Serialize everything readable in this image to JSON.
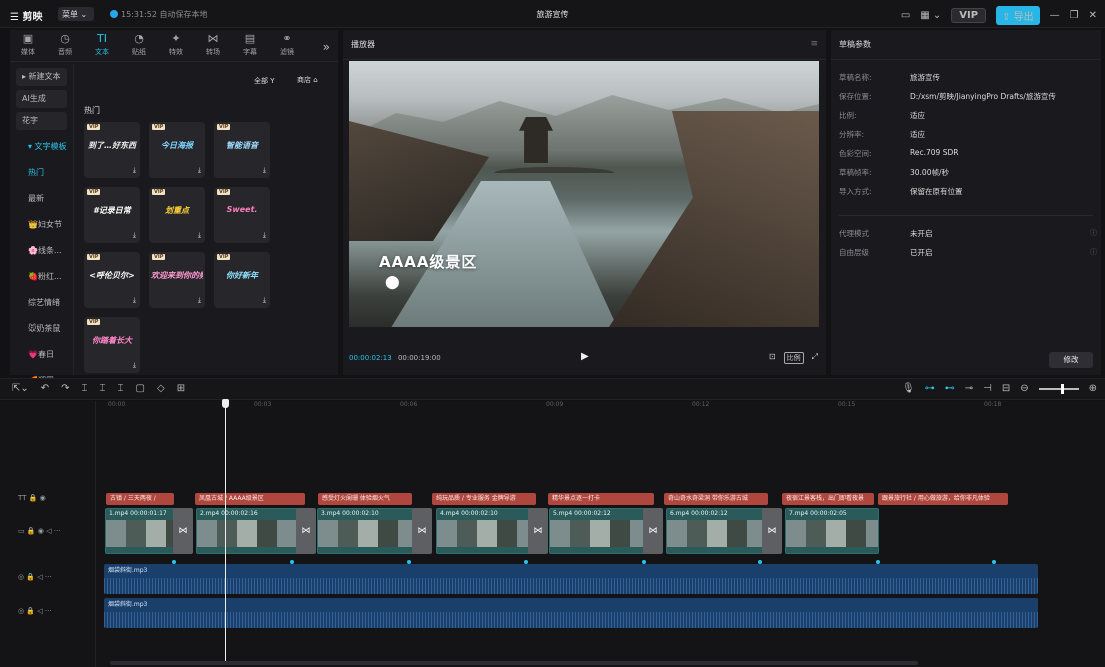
{
  "app": {
    "brand": "剪映",
    "menu_label": "菜单 ⌄",
    "save_status": "15:31:52 自动保存本地",
    "window_title": "旅游宣传",
    "vip_label": "VIP",
    "export_label": "导出"
  },
  "colors": {
    "accent": "#27c3e8",
    "text_clip": "#b0473f",
    "video_clip": "#2a5a5a",
    "audio_clip": "#1a3f6b"
  },
  "left_panel": {
    "tabs": [
      {
        "label": "媒体",
        "icon": "media-icon"
      },
      {
        "label": "音频",
        "icon": "audio-icon"
      },
      {
        "label": "文本",
        "icon": "text-icon",
        "active": true
      },
      {
        "label": "贴纸",
        "icon": "sticker-icon"
      },
      {
        "label": "特效",
        "icon": "effects-icon"
      },
      {
        "label": "转场",
        "icon": "transition-icon"
      },
      {
        "label": "字幕",
        "icon": "subtitle-icon"
      },
      {
        "label": "滤镜",
        "icon": "filter-icon"
      }
    ],
    "categories": [
      "▸ 新建文本",
      "AI生成",
      "花字",
      "▾ 文字模板",
      "热门",
      "最新",
      "👑妇女节",
      "🌸线条...",
      "🍓粉红...",
      "综艺情绪",
      "🐭奶茶鼠",
      "💗春日",
      "🌈遛罗..."
    ],
    "filter_label": "全部",
    "store_label": "商店",
    "section_title": "热门",
    "templates": [
      {
        "text": "到了…好东西",
        "color": "#f0f0f0"
      },
      {
        "text": "今日海报",
        "color": "#7fd6ff"
      },
      {
        "text": "智能语音",
        "color": "#9fdcff"
      },
      {
        "text": "#记录日常",
        "color": "#ffffff"
      },
      {
        "text": "划重点",
        "color": "#ffd23a"
      },
      {
        "text": "Sweet.",
        "color": "#ff7fbf"
      },
      {
        "text": "<呼伦贝尔>",
        "color": "#ffffff"
      },
      {
        "text": "欢迎来到你的频道",
        "color": "#ff9bd0"
      },
      {
        "text": "你好新年",
        "color": "#8fe3ff"
      },
      {
        "text": "你踏着长大",
        "color": "#ff86c8"
      }
    ]
  },
  "player": {
    "title": "播放器",
    "overlay_text": "AAAA级景区",
    "current_time": "00:00:02:13",
    "total_time": "00:00:19:00",
    "ratio_label": "比例"
  },
  "draft": {
    "title": "草稿参数",
    "fields": [
      {
        "label": "草稿名称:",
        "value": "旅游宣传"
      },
      {
        "label": "保存位置:",
        "value": "D:/xsm/剪映/JianyingPro Drafts/旅游宣传"
      },
      {
        "label": "比例:",
        "value": "适应"
      },
      {
        "label": "分辨率:",
        "value": "适应"
      },
      {
        "label": "色彩空间:",
        "value": "Rec.709 SDR"
      },
      {
        "label": "草稿帧率:",
        "value": "30.00帧/秒"
      },
      {
        "label": "导入方式:",
        "value": "保留在原有位置"
      }
    ],
    "extra": [
      {
        "label": "代理模式",
        "value": "未开启"
      },
      {
        "label": "自由层级",
        "value": "已开启"
      }
    ],
    "modify_label": "修改"
  },
  "timeline": {
    "ruler": [
      "00:00",
      "00:03",
      "00:06",
      "00:09",
      "00:12",
      "00:15",
      "00:18"
    ],
    "text_clips": [
      "古镇 / 三天两夜 /",
      "凤凰古城 / AAAA级景区",
      "感受灯火阑珊 体验烟火气",
      "纯玩品质 / 专业服务 金牌导游",
      "精华景点逐一打卡",
      "奇山奇水奇梁洞 带你乐游古城",
      "夜宿江景客栈，出门即看夜景",
      "跟景旅行社 / 用心做旅游，给你非凡体验"
    ],
    "video_clips": [
      {
        "name": "1.mp4",
        "duration": "00:00:01:17"
      },
      {
        "name": "2.mp4",
        "duration": "00:00:02:16"
      },
      {
        "name": "3.mp4",
        "duration": "00:00:02:10"
      },
      {
        "name": "4.mp4",
        "duration": "00:00:02:10"
      },
      {
        "name": "5.mp4",
        "duration": "00:00:02:12"
      },
      {
        "name": "6.mp4",
        "duration": "00:00:02:12"
      },
      {
        "name": "7.mp4",
        "duration": "00:00:02:05"
      }
    ],
    "audio_clips": [
      "烟袋斜街.mp3",
      "烟袋斜街.mp3"
    ]
  }
}
